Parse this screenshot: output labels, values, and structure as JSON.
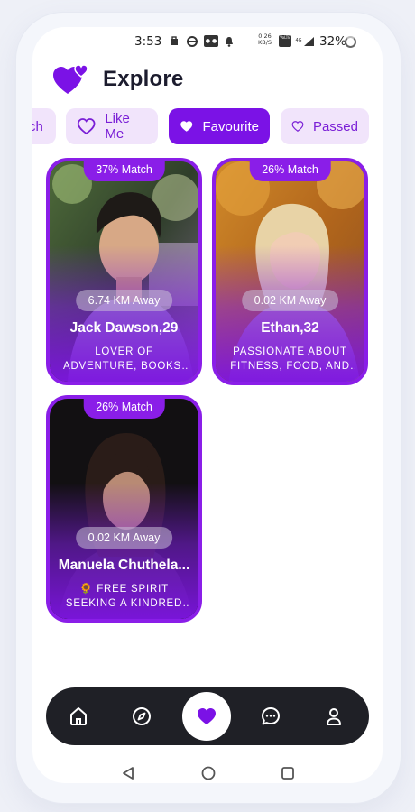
{
  "status_bar": {
    "time": "3:53",
    "speed_value": "0.26",
    "speed_unit": "KB/S",
    "badge_volte": "VoLTE",
    "badge_4g": "4G",
    "battery": "32%",
    "icons": [
      "sim-icon",
      "link-icon",
      "hotspot-icon",
      "bell-icon",
      "wifi-calling-icon",
      "signal-icon",
      "battery-ring-icon"
    ]
  },
  "header": {
    "title": "Explore",
    "logo": "hearts-logo-icon"
  },
  "tabs": [
    {
      "label": "ch",
      "icon": "heart-outline-icon",
      "active": false
    },
    {
      "label": "Like Me",
      "icon": "heart-outline-icon",
      "active": false
    },
    {
      "label": "Favourite",
      "icon": "heart-filled-icon",
      "active": true
    },
    {
      "label": "Passed",
      "icon": "heart-outline-icon",
      "active": false
    }
  ],
  "cards": [
    {
      "match": "37% Match",
      "distance": "6.74 KM Away",
      "name": "Jack Dawson,29",
      "bio": "LOVER OF ADVENTURE, BOOKS, AND STRONG..."
    },
    {
      "match": "26% Match",
      "distance": "0.02 KM Away",
      "name": "Ethan,32",
      "bio": "PASSIONATE ABOUT FITNESS, FOOD, AND ..."
    },
    {
      "match": "26% Match",
      "distance": "0.02 KM Away",
      "name": "Manuela Chuthela...",
      "bio": "🌻 FREE SPIRIT SEEKING A KINDRED ..."
    }
  ],
  "bottom_nav": [
    {
      "name": "home",
      "icon": "home-icon"
    },
    {
      "name": "explore",
      "icon": "compass-icon"
    },
    {
      "name": "favourites",
      "icon": "heart-filled-icon",
      "active": true
    },
    {
      "name": "messages",
      "icon": "chat-icon"
    },
    {
      "name": "profile",
      "icon": "user-icon"
    }
  ],
  "colors": {
    "accent": "#7b12e6",
    "tab_bg": "#f1e4fb",
    "nav_bg": "#1f2026"
  }
}
